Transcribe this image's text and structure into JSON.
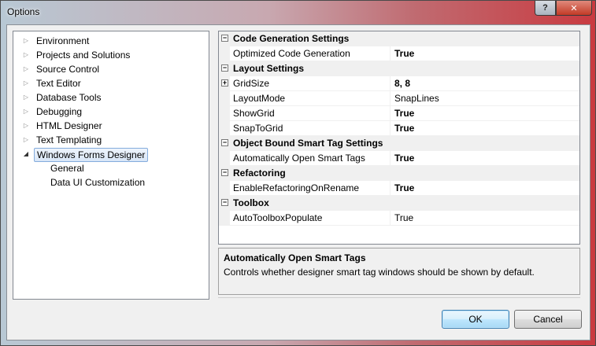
{
  "window": {
    "title": "Options"
  },
  "titlebar_buttons": {
    "help": "?",
    "close": "✕"
  },
  "tree": [
    {
      "label": "Environment",
      "expandable": true
    },
    {
      "label": "Projects and Solutions",
      "expandable": true
    },
    {
      "label": "Source Control",
      "expandable": true
    },
    {
      "label": "Text Editor",
      "expandable": true
    },
    {
      "label": "Database Tools",
      "expandable": true
    },
    {
      "label": "Debugging",
      "expandable": true
    },
    {
      "label": "HTML Designer",
      "expandable": true
    },
    {
      "label": "Text Templating",
      "expandable": true
    },
    {
      "label": "Windows Forms Designer",
      "expanded": true,
      "selected": true
    },
    {
      "label": "General",
      "child": true
    },
    {
      "label": "Data UI Customization",
      "child": true
    }
  ],
  "property_grid": {
    "rows": [
      {
        "type": "category",
        "expander": "−",
        "name": "Code Generation Settings"
      },
      {
        "type": "property",
        "name": "Optimized Code Generation",
        "value": "True",
        "bold": true
      },
      {
        "type": "category",
        "expander": "−",
        "name": "Layout Settings"
      },
      {
        "type": "property",
        "name": "GridSize",
        "value": "8, 8",
        "bold": true,
        "expander": "+"
      },
      {
        "type": "property",
        "name": "LayoutMode",
        "value": "SnapLines",
        "bold": false
      },
      {
        "type": "property",
        "name": "ShowGrid",
        "value": "True",
        "bold": true
      },
      {
        "type": "property",
        "name": "SnapToGrid",
        "value": "True",
        "bold": true
      },
      {
        "type": "category",
        "expander": "−",
        "name": "Object Bound Smart Tag Settings"
      },
      {
        "type": "property",
        "name": "Automatically Open Smart Tags",
        "value": "True",
        "bold": true
      },
      {
        "type": "category",
        "expander": "−",
        "name": "Refactoring"
      },
      {
        "type": "property",
        "name": "EnableRefactoringOnRename",
        "value": "True",
        "bold": true
      },
      {
        "type": "category",
        "expander": "−",
        "name": "Toolbox"
      },
      {
        "type": "property",
        "name": "AutoToolboxPopulate",
        "value": "True",
        "bold": false
      }
    ]
  },
  "description": {
    "title": "Automatically Open Smart Tags",
    "text": "Controls whether designer smart tag windows should be shown by default."
  },
  "buttons": {
    "ok": "OK",
    "cancel": "Cancel"
  }
}
